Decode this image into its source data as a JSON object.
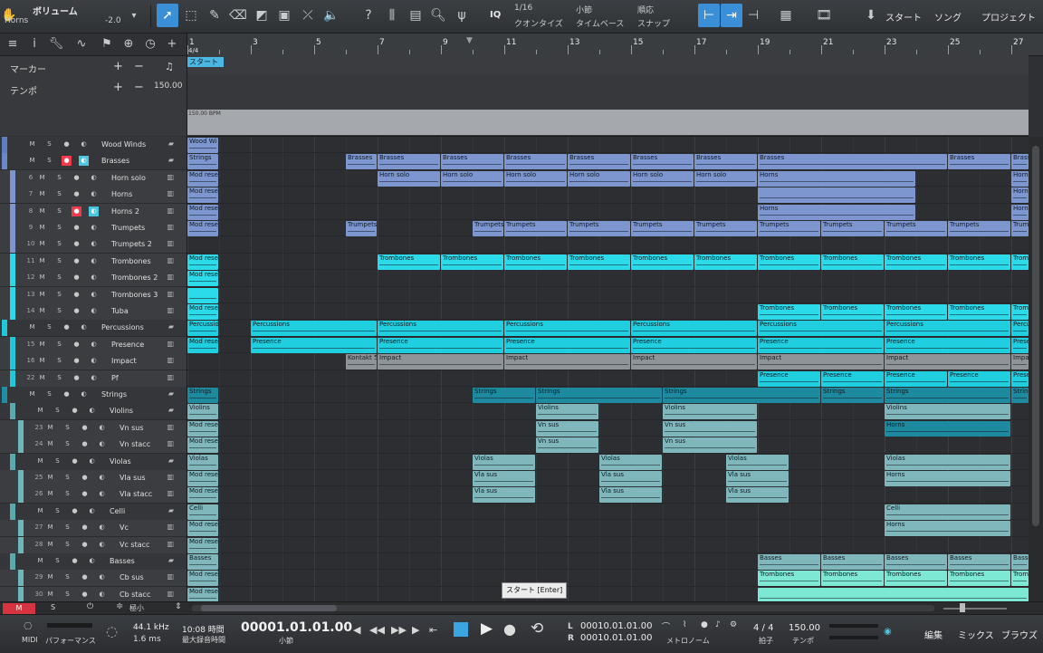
{
  "toolbar": {
    "title": "ボリューム",
    "subtitle": "Horns",
    "value": "-2.0",
    "quantize_value": "1/16",
    "quantize_label": "クオンタイズ",
    "timebase_value": "小節",
    "timebase_label": "タイムベース",
    "snap_value": "順応",
    "snap_label": "スナップ",
    "iq_label": "IQ",
    "start_label": "スタート",
    "song_label": "ソング",
    "project_label": "プロジェクト"
  },
  "left_top": {
    "marker_label": "マーカー",
    "tempo_label": "テンポ",
    "tempo_value": "150.00"
  },
  "ruler": {
    "bars": [
      "1",
      "3",
      "5",
      "7",
      "9",
      "11",
      "13",
      "15",
      "17",
      "19",
      "21",
      "23",
      "25",
      "27"
    ],
    "signature": "4/4",
    "start_marker": "スタート",
    "tempo_text": "150.00 BPM"
  },
  "tracks": [
    {
      "num": "",
      "name": "Wood Winds",
      "folder": true,
      "color": "#5b7fbf",
      "indent": 0
    },
    {
      "num": "",
      "name": "Brasses",
      "folder": true,
      "color": "#6c87c7",
      "indent": 0,
      "rec": true,
      "mon": true
    },
    {
      "num": "6",
      "name": "Horn solo",
      "color": "#7d95cf",
      "indent": 1
    },
    {
      "num": "7",
      "name": "Horns",
      "color": "#7d95cf",
      "indent": 1
    },
    {
      "num": "8",
      "name": "Horns 2",
      "color": "#7d95cf",
      "indent": 1,
      "rec": true,
      "mon": true
    },
    {
      "num": "9",
      "name": "Trumpets",
      "color": "#7d95cf",
      "indent": 1
    },
    {
      "num": "10",
      "name": "Trumpets 2",
      "color": "#7d95cf",
      "indent": 1
    },
    {
      "num": "11",
      "name": "Trombones",
      "color": "#2cd8e6",
      "indent": 1
    },
    {
      "num": "12",
      "name": "Trombones 2",
      "color": "#2cd8e6",
      "indent": 1
    },
    {
      "num": "13",
      "name": "Trombones 3",
      "color": "#2cd8e6",
      "indent": 1
    },
    {
      "num": "14",
      "name": "Tuba",
      "color": "#2cd8e6",
      "indent": 1
    },
    {
      "num": "",
      "name": "Percussions",
      "folder": true,
      "color": "#1ec8d8",
      "indent": 0
    },
    {
      "num": "15",
      "name": "Presence",
      "color": "#1ec8d8",
      "indent": 1
    },
    {
      "num": "16",
      "name": "Impact",
      "color": "#1ec8d8",
      "indent": 1
    },
    {
      "num": "22",
      "name": "Pf",
      "color": "#1ec8d8",
      "indent": 1
    },
    {
      "num": "",
      "name": "Strings",
      "folder": true,
      "color": "#1e8fa6",
      "indent": 0
    },
    {
      "num": "",
      "name": "Violins",
      "folder": true,
      "color": "#5aa8b0",
      "indent": 1
    },
    {
      "num": "23",
      "name": "Vn sus",
      "color": "#6fb6bc",
      "indent": 2
    },
    {
      "num": "24",
      "name": "Vn stacc",
      "color": "#6fb6bc",
      "indent": 2
    },
    {
      "num": "",
      "name": "Violas",
      "folder": true,
      "color": "#5aa8b0",
      "indent": 1
    },
    {
      "num": "25",
      "name": "Vla sus",
      "color": "#6fb6bc",
      "indent": 2
    },
    {
      "num": "26",
      "name": "Vla stacc",
      "color": "#6fb6bc",
      "indent": 2
    },
    {
      "num": "",
      "name": "Celli",
      "folder": true,
      "color": "#5aa8b0",
      "indent": 1
    },
    {
      "num": "27",
      "name": "Vc",
      "color": "#6fb6bc",
      "indent": 2
    },
    {
      "num": "28",
      "name": "Vc stacc",
      "color": "#6fb6bc",
      "indent": 2
    },
    {
      "num": "",
      "name": "Basses",
      "folder": true,
      "color": "#5aa8b0",
      "indent": 1
    },
    {
      "num": "29",
      "name": "Cb sus",
      "color": "#6fb6bc",
      "indent": 2
    },
    {
      "num": "30",
      "name": "Cb stacc",
      "color": "#6fb6bc",
      "indent": 2
    }
  ],
  "clips": [
    {
      "r": 0,
      "a": 1,
      "b": 2,
      "t": "Wood Wi",
      "c": "#7d96d0"
    },
    {
      "r": 1,
      "a": 1,
      "b": 2,
      "t": "Strings",
      "c": "#7d96d0"
    },
    {
      "r": 1,
      "a": 6,
      "b": 7,
      "t": "Brasses",
      "c": "#7d96d0"
    },
    {
      "r": 1,
      "a": 7,
      "b": 9,
      "t": "Brasses",
      "c": "#7d96d0"
    },
    {
      "r": 1,
      "a": 9,
      "b": 11,
      "t": "Brasses",
      "c": "#7d96d0"
    },
    {
      "r": 1,
      "a": 11,
      "b": 13,
      "t": "Brasses",
      "c": "#7d96d0"
    },
    {
      "r": 1,
      "a": 13,
      "b": 15,
      "t": "Brasses",
      "c": "#7d96d0"
    },
    {
      "r": 1,
      "a": 15,
      "b": 17,
      "t": "Brasses",
      "c": "#7d96d0"
    },
    {
      "r": 1,
      "a": 17,
      "b": 19,
      "t": "Brasses",
      "c": "#7d96d0"
    },
    {
      "r": 1,
      "a": 19,
      "b": 25,
      "t": "Brasses",
      "c": "#7d96d0"
    },
    {
      "r": 1,
      "a": 25,
      "b": 27,
      "t": "Brasses",
      "c": "#7d96d0"
    },
    {
      "r": 1,
      "a": 27,
      "b": 28,
      "t": "Brasses",
      "c": "#7d96d0"
    },
    {
      "r": 2,
      "a": 1,
      "b": 2,
      "t": "Mod rese",
      "c": "#7d96d0"
    },
    {
      "r": 2,
      "a": 7,
      "b": 9,
      "t": "Horn solo",
      "c": "#7d96d0"
    },
    {
      "r": 2,
      "a": 9,
      "b": 11,
      "t": "Horn solo",
      "c": "#7d96d0"
    },
    {
      "r": 2,
      "a": 11,
      "b": 13,
      "t": "Horn solo",
      "c": "#7d96d0"
    },
    {
      "r": 2,
      "a": 13,
      "b": 15,
      "t": "Horn solo",
      "c": "#7d96d0"
    },
    {
      "r": 2,
      "a": 15,
      "b": 17,
      "t": "Horn solo",
      "c": "#7d96d0"
    },
    {
      "r": 2,
      "a": 17,
      "b": 19,
      "t": "Horn solo",
      "c": "#7d96d0"
    },
    {
      "r": 2,
      "a": 19,
      "b": 24,
      "t": "Horns",
      "c": "#7d96d0"
    },
    {
      "r": 2,
      "a": 27,
      "b": 28,
      "t": "Horns",
      "c": "#7d96d0"
    },
    {
      "r": 3,
      "a": 1,
      "b": 2,
      "t": "Mod rese",
      "c": "#7d96d0"
    },
    {
      "r": 3,
      "a": 19,
      "b": 24,
      "t": "",
      "c": "#7d96d0"
    },
    {
      "r": 3,
      "a": 27,
      "b": 28,
      "t": "Horns",
      "c": "#7d96d0"
    },
    {
      "r": 4,
      "a": 1,
      "b": 2,
      "t": "Mod rese",
      "c": "#7d96d0"
    },
    {
      "r": 4,
      "a": 19,
      "b": 24,
      "t": "Horns",
      "c": "#7d96d0"
    },
    {
      "r": 4,
      "a": 27,
      "b": 28,
      "t": "Horns",
      "c": "#7d96d0"
    },
    {
      "r": 5,
      "a": 1,
      "b": 2,
      "t": "Mod rese",
      "c": "#7d96d0"
    },
    {
      "r": 5,
      "a": 6,
      "b": 7,
      "t": "Trumpets",
      "c": "#7d96d0"
    },
    {
      "r": 5,
      "a": 10,
      "b": 11,
      "t": "Trumpets",
      "c": "#7d96d0"
    },
    {
      "r": 5,
      "a": 11,
      "b": 13,
      "t": "Trumpets",
      "c": "#7d96d0"
    },
    {
      "r": 5,
      "a": 13,
      "b": 15,
      "t": "Trumpets",
      "c": "#7d96d0"
    },
    {
      "r": 5,
      "a": 15,
      "b": 17,
      "t": "Trumpets",
      "c": "#7d96d0"
    },
    {
      "r": 5,
      "a": 17,
      "b": 19,
      "t": "Trumpets",
      "c": "#7d96d0"
    },
    {
      "r": 5,
      "a": 19,
      "b": 21,
      "t": "Trumpets",
      "c": "#7d96d0"
    },
    {
      "r": 5,
      "a": 21,
      "b": 23,
      "t": "Trumpets",
      "c": "#7d96d0"
    },
    {
      "r": 5,
      "a": 23,
      "b": 25,
      "t": "Trumpets",
      "c": "#7d96d0"
    },
    {
      "r": 5,
      "a": 25,
      "b": 27,
      "t": "Trumpets",
      "c": "#7d96d0"
    },
    {
      "r": 5,
      "a": 27,
      "b": 28,
      "t": "Trumpets",
      "c": "#7d96d0"
    },
    {
      "r": 7,
      "a": 1,
      "b": 2,
      "t": "Mod rese",
      "c": "#2cdbe9"
    },
    {
      "r": 7,
      "a": 7,
      "b": 9,
      "t": "Trombones",
      "c": "#2cdbe9"
    },
    {
      "r": 7,
      "a": 9,
      "b": 11,
      "t": "Trombones",
      "c": "#2cdbe9"
    },
    {
      "r": 7,
      "a": 11,
      "b": 13,
      "t": "Trombones",
      "c": "#2cdbe9"
    },
    {
      "r": 7,
      "a": 13,
      "b": 15,
      "t": "Trombones",
      "c": "#2cdbe9"
    },
    {
      "r": 7,
      "a": 15,
      "b": 17,
      "t": "Trombones",
      "c": "#2cdbe9"
    },
    {
      "r": 7,
      "a": 17,
      "b": 19,
      "t": "Trombones",
      "c": "#2cdbe9"
    },
    {
      "r": 7,
      "a": 19,
      "b": 21,
      "t": "Trombones",
      "c": "#2cdbe9"
    },
    {
      "r": 7,
      "a": 21,
      "b": 23,
      "t": "Trombones",
      "c": "#2cdbe9"
    },
    {
      "r": 7,
      "a": 23,
      "b": 25,
      "t": "Trombones",
      "c": "#2cdbe9"
    },
    {
      "r": 7,
      "a": 25,
      "b": 27,
      "t": "Trombones",
      "c": "#2cdbe9"
    },
    {
      "r": 7,
      "a": 27,
      "b": 28,
      "t": "Trombones",
      "c": "#2cdbe9"
    },
    {
      "r": 8,
      "a": 1,
      "b": 2,
      "t": "Mod rese",
      "c": "#2cdbe9"
    },
    {
      "r": 9,
      "a": 1,
      "b": 2,
      "t": "",
      "c": "#2cdbe9"
    },
    {
      "r": 10,
      "a": 1,
      "b": 2,
      "t": "Mod rese",
      "c": "#2cdbe9"
    },
    {
      "r": 10,
      "a": 19,
      "b": 21,
      "t": "Trombones",
      "c": "#2cdbe9"
    },
    {
      "r": 10,
      "a": 21,
      "b": 23,
      "t": "Trombones",
      "c": "#2cdbe9"
    },
    {
      "r": 10,
      "a": 23,
      "b": 25,
      "t": "Trombones",
      "c": "#2cdbe9"
    },
    {
      "r": 10,
      "a": 25,
      "b": 27,
      "t": "Trombones",
      "c": "#2cdbe9"
    },
    {
      "r": 10,
      "a": 27,
      "b": 28,
      "t": "Trombones",
      "c": "#2cdbe9"
    },
    {
      "r": 11,
      "a": 1,
      "b": 2,
      "t": "Percussio",
      "c": "#1fcfe0"
    },
    {
      "r": 11,
      "a": 3,
      "b": 7,
      "t": "Percussions",
      "c": "#1fcfe0"
    },
    {
      "r": 11,
      "a": 7,
      "b": 11,
      "t": "Percussions",
      "c": "#1fcfe0"
    },
    {
      "r": 11,
      "a": 11,
      "b": 15,
      "t": "Percussions",
      "c": "#1fcfe0"
    },
    {
      "r": 11,
      "a": 15,
      "b": 19,
      "t": "Percussions",
      "c": "#1fcfe0"
    },
    {
      "r": 11,
      "a": 19,
      "b": 23,
      "t": "Percussions",
      "c": "#1fcfe0"
    },
    {
      "r": 11,
      "a": 23,
      "b": 27,
      "t": "Percussions",
      "c": "#1fcfe0"
    },
    {
      "r": 11,
      "a": 27,
      "b": 28,
      "t": "Percussions",
      "c": "#1fcfe0"
    },
    {
      "r": 12,
      "a": 1,
      "b": 2,
      "t": "Mod rese",
      "c": "#1fcfe0"
    },
    {
      "r": 12,
      "a": 3,
      "b": 7,
      "t": "Presence",
      "c": "#1fcfe0"
    },
    {
      "r": 12,
      "a": 7,
      "b": 11,
      "t": "Presence",
      "c": "#1fcfe0"
    },
    {
      "r": 12,
      "a": 11,
      "b": 15,
      "t": "Presence",
      "c": "#1fcfe0"
    },
    {
      "r": 12,
      "a": 15,
      "b": 19,
      "t": "Presence",
      "c": "#1fcfe0"
    },
    {
      "r": 12,
      "a": 19,
      "b": 23,
      "t": "Presence",
      "c": "#1fcfe0"
    },
    {
      "r": 12,
      "a": 23,
      "b": 27,
      "t": "Presence",
      "c": "#1fcfe0"
    },
    {
      "r": 12,
      "a": 27,
      "b": 28,
      "t": "Presence",
      "c": "#1fcfe0"
    },
    {
      "r": 13,
      "a": 6,
      "b": 7,
      "t": "Kontakt 5",
      "c": "#8f9498"
    },
    {
      "r": 13,
      "a": 7,
      "b": 11,
      "t": "Impact",
      "c": "#8f9498"
    },
    {
      "r": 13,
      "a": 11,
      "b": 15,
      "t": "Impact",
      "c": "#8f9498"
    },
    {
      "r": 13,
      "a": 15,
      "b": 19,
      "t": "Impact",
      "c": "#8f9498"
    },
    {
      "r": 13,
      "a": 19,
      "b": 23,
      "t": "Impact",
      "c": "#8f9498"
    },
    {
      "r": 13,
      "a": 23,
      "b": 27,
      "t": "Impact",
      "c": "#8f9498"
    },
    {
      "r": 13,
      "a": 27,
      "b": 28,
      "t": "Impact",
      "c": "#8f9498"
    },
    {
      "r": 14,
      "a": 19,
      "b": 21,
      "t": "Presence",
      "c": "#1fcfe0"
    },
    {
      "r": 14,
      "a": 21,
      "b": 23,
      "t": "Presence",
      "c": "#1fcfe0"
    },
    {
      "r": 14,
      "a": 23,
      "b": 25,
      "t": "Presence",
      "c": "#1fcfe0"
    },
    {
      "r": 14,
      "a": 25,
      "b": 27,
      "t": "Presence",
      "c": "#1fcfe0"
    },
    {
      "r": 14,
      "a": 27,
      "b": 28,
      "t": "Presence",
      "c": "#1fcfe0"
    },
    {
      "r": 15,
      "a": 1,
      "b": 2,
      "t": "Strings",
      "c": "#1d8aa0"
    },
    {
      "r": 15,
      "a": 10,
      "b": 12,
      "t": "Strings",
      "c": "#1d8aa0"
    },
    {
      "r": 15,
      "a": 12,
      "b": 16,
      "t": "Strings",
      "c": "#1d8aa0"
    },
    {
      "r": 15,
      "a": 16,
      "b": 21,
      "t": "Strings",
      "c": "#1d8aa0"
    },
    {
      "r": 15,
      "a": 21,
      "b": 23,
      "t": "Strings",
      "c": "#1d8aa0"
    },
    {
      "r": 15,
      "a": 23,
      "b": 27,
      "t": "Strings",
      "c": "#1d8aa0"
    },
    {
      "r": 15,
      "a": 27,
      "b": 28,
      "t": "Strings",
      "c": "#1d8aa0"
    },
    {
      "r": 16,
      "a": 1,
      "b": 2,
      "t": "Violins",
      "c": "#7fb7bd"
    },
    {
      "r": 16,
      "a": 12,
      "b": 14,
      "t": "Violins",
      "c": "#7fb7bd"
    },
    {
      "r": 16,
      "a": 16,
      "b": 19,
      "t": "Violins",
      "c": "#7fb7bd"
    },
    {
      "r": 16,
      "a": 23,
      "b": 27,
      "t": "Violins",
      "c": "#7fb7bd"
    },
    {
      "r": 17,
      "a": 1,
      "b": 2,
      "t": "Mod rese",
      "c": "#7fb7bd"
    },
    {
      "r": 17,
      "a": 12,
      "b": 14,
      "t": "Vn sus",
      "c": "#7fb7bd"
    },
    {
      "r": 17,
      "a": 16,
      "b": 19,
      "t": "Vn sus",
      "c": "#7fb7bd"
    },
    {
      "r": 17,
      "a": 23,
      "b": 27,
      "t": "Horns",
      "c": "#1d8aa0"
    },
    {
      "r": 18,
      "a": 1,
      "b": 2,
      "t": "Mod rese",
      "c": "#7fb7bd"
    },
    {
      "r": 18,
      "a": 12,
      "b": 14,
      "t": "Vn sus",
      "c": "#7fb7bd"
    },
    {
      "r": 18,
      "a": 16,
      "b": 19,
      "t": "Vn sus",
      "c": "#7fb7bd"
    },
    {
      "r": 19,
      "a": 1,
      "b": 2,
      "t": "Violas",
      "c": "#7fb7bd"
    },
    {
      "r": 19,
      "a": 10,
      "b": 12,
      "t": "Violas",
      "c": "#7fb7bd"
    },
    {
      "r": 19,
      "a": 14,
      "b": 16,
      "t": "Violas",
      "c": "#7fb7bd"
    },
    {
      "r": 19,
      "a": 18,
      "b": 20,
      "t": "Violas",
      "c": "#7fb7bd"
    },
    {
      "r": 19,
      "a": 23,
      "b": 27,
      "t": "Violas",
      "c": "#7fb7bd"
    },
    {
      "r": 20,
      "a": 1,
      "b": 2,
      "t": "Mod rese",
      "c": "#7fb7bd"
    },
    {
      "r": 20,
      "a": 10,
      "b": 12,
      "t": "Vla sus",
      "c": "#7fb7bd"
    },
    {
      "r": 20,
      "a": 14,
      "b": 16,
      "t": "Vla sus",
      "c": "#7fb7bd"
    },
    {
      "r": 20,
      "a": 18,
      "b": 20,
      "t": "Vla sus",
      "c": "#7fb7bd"
    },
    {
      "r": 20,
      "a": 23,
      "b": 27,
      "t": "Horns",
      "c": "#7fb7bd"
    },
    {
      "r": 21,
      "a": 1,
      "b": 2,
      "t": "Mod rese",
      "c": "#7fb7bd"
    },
    {
      "r": 21,
      "a": 10,
      "b": 12,
      "t": "Vla sus",
      "c": "#7fb7bd"
    },
    {
      "r": 21,
      "a": 14,
      "b": 16,
      "t": "Vla sus",
      "c": "#7fb7bd"
    },
    {
      "r": 21,
      "a": 18,
      "b": 20,
      "t": "Vla sus",
      "c": "#7fb7bd"
    },
    {
      "r": 22,
      "a": 1,
      "b": 2,
      "t": "Celli",
      "c": "#7fb7bd"
    },
    {
      "r": 22,
      "a": 23,
      "b": 27,
      "t": "Celli",
      "c": "#7fb7bd"
    },
    {
      "r": 23,
      "a": 1,
      "b": 2,
      "t": "Mod rese",
      "c": "#7fb7bd"
    },
    {
      "r": 23,
      "a": 23,
      "b": 27,
      "t": "Horns",
      "c": "#7fb7bd"
    },
    {
      "r": 24,
      "a": 1,
      "b": 2,
      "t": "Mod rese",
      "c": "#7fb7bd"
    },
    {
      "r": 25,
      "a": 1,
      "b": 2,
      "t": "Basses",
      "c": "#7fb7bd"
    },
    {
      "r": 25,
      "a": 19,
      "b": 21,
      "t": "Basses",
      "c": "#7fb7bd"
    },
    {
      "r": 25,
      "a": 21,
      "b": 23,
      "t": "Basses",
      "c": "#7fb7bd"
    },
    {
      "r": 25,
      "a": 23,
      "b": 25,
      "t": "Basses",
      "c": "#7fb7bd"
    },
    {
      "r": 25,
      "a": 25,
      "b": 27,
      "t": "Basses",
      "c": "#7fb7bd"
    },
    {
      "r": 25,
      "a": 27,
      "b": 28,
      "t": "Basses",
      "c": "#7fb7bd"
    },
    {
      "r": 26,
      "a": 1,
      "b": 2,
      "t": "Mod rese",
      "c": "#7fb7bd"
    },
    {
      "r": 26,
      "a": 19,
      "b": 21,
      "t": "Trombones",
      "c": "#7de8d4"
    },
    {
      "r": 26,
      "a": 21,
      "b": 23,
      "t": "Trombones",
      "c": "#7de8d4"
    },
    {
      "r": 26,
      "a": 23,
      "b": 25,
      "t": "Trombones",
      "c": "#7de8d4"
    },
    {
      "r": 26,
      "a": 25,
      "b": 27,
      "t": "Trombones",
      "c": "#7de8d4"
    },
    {
      "r": 26,
      "a": 27,
      "b": 28,
      "t": "Trombones",
      "c": "#7de8d4"
    },
    {
      "r": 27,
      "a": 1,
      "b": 2,
      "t": "Mod rese",
      "c": "#7fb7bd"
    },
    {
      "r": 27,
      "a": 19,
      "b": 28,
      "t": "",
      "c": "#7de8d4"
    }
  ],
  "bottom_left": {
    "m_label": "M",
    "s_label": "S",
    "zoom_label": "極小"
  },
  "transport": {
    "midi_label": "MIDI",
    "performance_label": "パフォーマンス",
    "sample_rate": "44.1 kHz",
    "latency": "1.6 ms",
    "time_value": "10:08 時間",
    "max_rec_label": "最大録音時間",
    "position": "00001.01.01.00",
    "position_unit": "小節",
    "loop_l": "00010.01.01.00",
    "loop_r": "00010.01.01.00",
    "l_label": "L",
    "r_label": "R",
    "metronome_label": "メトロノーム",
    "signature": "4 / 4",
    "signature_label": "拍子",
    "tempo": "150.00",
    "tempo_label": "テンポ",
    "edit_label": "編集",
    "mix_label": "ミックス",
    "browse_label": "ブラウズ",
    "tooltip": "スタート [Enter]"
  },
  "colors": {
    "accent": "#3a8fd6",
    "record": "#f03c4a",
    "monitor": "#4cc6e0"
  }
}
